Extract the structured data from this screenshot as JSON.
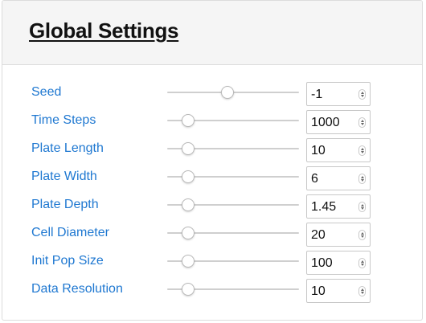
{
  "panel": {
    "title": "Global Settings"
  },
  "settings": [
    {
      "label": "Seed",
      "value": "-1",
      "slider_fraction": 0.46
    },
    {
      "label": "Time Steps",
      "value": "1000",
      "slider_fraction": 0.16
    },
    {
      "label": "Plate Length",
      "value": "10",
      "slider_fraction": 0.16
    },
    {
      "label": "Plate Width",
      "value": "6",
      "slider_fraction": 0.16
    },
    {
      "label": "Plate Depth",
      "value": "1.45",
      "slider_fraction": 0.16
    },
    {
      "label": "Cell Diameter",
      "value": "20",
      "slider_fraction": 0.16
    },
    {
      "label": "Init Pop Size",
      "value": "100",
      "slider_fraction": 0.16
    },
    {
      "label": "Data Resolution",
      "value": "10",
      "slider_fraction": 0.16
    }
  ],
  "colors": {
    "label": "#1f78d1",
    "header_bg": "#f5f5f5"
  },
  "icons": {
    "spinner": "up-down-arrows-icon"
  }
}
